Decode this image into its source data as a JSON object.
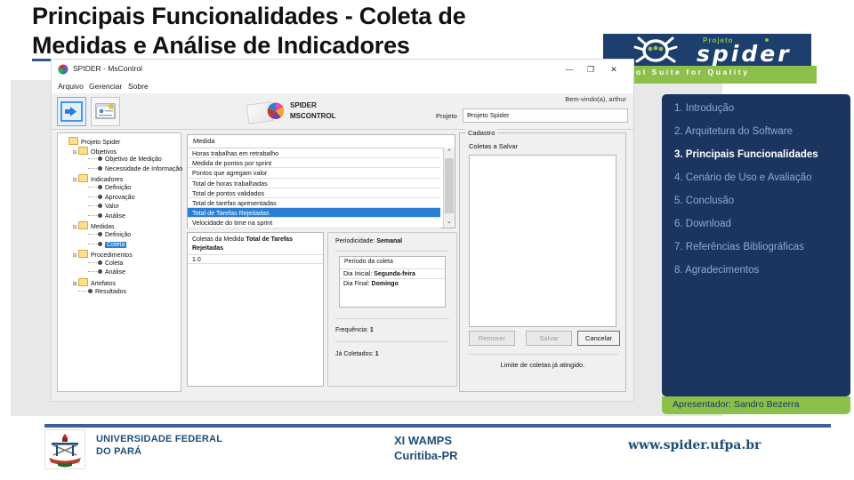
{
  "slide": {
    "title_line1": "Principais Funcionalidades - Coleta de",
    "title_line2": "Medidas e Análise de Indicadores",
    "accent_blue": "#1c3560",
    "accent_green": "#8cc04a",
    "rule_blue": "#3d6096"
  },
  "spider_logo": {
    "projeto": "Projeto",
    "word": "spider",
    "tagline": "Tool Suite for Quality"
  },
  "app": {
    "window_title": "SPIDER - MsControl",
    "controls": {
      "minimize": "—",
      "maximize": "❐",
      "close": "✕"
    },
    "menu": [
      "Arquivo",
      "Gerenciar",
      "Sobre"
    ],
    "logo_line1": "SPIDER",
    "logo_line2": "MSCONTROL",
    "welcome": "Bem-vindo(a), arthur",
    "project_label": "Projeto",
    "project_value": "Projeto Spider",
    "project_chevron": "⌄",
    "tree": [
      {
        "label": "Projeto Spider",
        "depth": 0,
        "kind": "folder",
        "expander": ""
      },
      {
        "label": "Objetivos",
        "depth": 1,
        "kind": "folder",
        "expander": "−"
      },
      {
        "label": "Objetivo de Medição",
        "depth": 2,
        "kind": "leaf",
        "expander": ""
      },
      {
        "label": "Necessidade de Informação",
        "depth": 2,
        "kind": "leaf",
        "expander": ""
      },
      {
        "label": "Indicadores",
        "depth": 1,
        "kind": "folder",
        "expander": "−"
      },
      {
        "label": "Definição",
        "depth": 2,
        "kind": "leaf",
        "expander": ""
      },
      {
        "label": "Aprovação",
        "depth": 2,
        "kind": "leaf",
        "expander": ""
      },
      {
        "label": "Valor",
        "depth": 2,
        "kind": "leaf",
        "expander": ""
      },
      {
        "label": "Análise",
        "depth": 2,
        "kind": "leaf",
        "expander": ""
      },
      {
        "label": "Medidas",
        "depth": 1,
        "kind": "folder",
        "expander": "−"
      },
      {
        "label": "Definição",
        "depth": 2,
        "kind": "leaf",
        "expander": ""
      },
      {
        "label": "Coleta",
        "depth": 2,
        "kind": "leaf",
        "expander": "",
        "selected": true
      },
      {
        "label": "Procedimentos",
        "depth": 1,
        "kind": "folder",
        "expander": "−"
      },
      {
        "label": "Coleta",
        "depth": 2,
        "kind": "leaf",
        "expander": ""
      },
      {
        "label": "Análise",
        "depth": 2,
        "kind": "leaf",
        "expander": ""
      },
      {
        "label": "Artefatos",
        "depth": 1,
        "kind": "folder",
        "expander": "+"
      },
      {
        "label": "Resultados",
        "depth": 1,
        "kind": "leaf",
        "expander": ""
      }
    ],
    "measure_list": {
      "header": "Medida",
      "rows": [
        "Horas trabalhas em retrabalho",
        "Medida de pontos por sprint",
        "Pontos que agregam valor",
        "Total de horas trabalhadas",
        "Total de pontos validados",
        "Total de tarefas apresentadas",
        "Total de Tarefas Rejeitadas",
        "Velocidade do time na sprint"
      ],
      "selected_index": 6,
      "scroll_up": "⌃",
      "scroll_down": "⌄"
    },
    "coletas": {
      "title_prefix": "Coletas da Medida ",
      "title_strong": "Total de Tarefas Rejeitadas",
      "value": "1.0"
    },
    "periodicidade": {
      "label": "Periodicidade: ",
      "value": "Semanal",
      "periodo_header": "Período da coleta",
      "dia_inicial_label": "Dia Inicial: ",
      "dia_inicial_value": "Segunda-feira",
      "dia_final_label": "Dia Final: ",
      "dia_final_value": "Domingo",
      "frequencia_label": "Frequência: ",
      "frequencia_value": "1",
      "coletados_label": "Já Coletados: ",
      "coletados_value": "1"
    },
    "cadastro": {
      "legend": "Cadastro",
      "sub_label": "Coletas a Salvar",
      "btn_remover": "Remover",
      "btn_salvar": "Salvar",
      "btn_cancelar": "Cancelar",
      "note": "Limite de coletas já atingido."
    }
  },
  "nav": {
    "items": [
      {
        "label": "1. Introdução",
        "active": false
      },
      {
        "label": "2. Arquitetura do Software",
        "active": false
      },
      {
        "label": "3. Principais  Funcionalidades",
        "active": true
      },
      {
        "label": "4. Cenário de Uso e Avaliação",
        "active": false
      },
      {
        "label": "5. Conclusão",
        "active": false
      },
      {
        "label": "6. Download",
        "active": false
      },
      {
        "label": "7. Referências Bibliográficas",
        "active": false
      },
      {
        "label": "8. Agradecimentos",
        "active": false
      }
    ],
    "presenter": "Apresentador: Sandro Bezerra"
  },
  "footer": {
    "university_line1": "UNIVERSIDADE FEDERAL",
    "university_line2": "DO PARÁ",
    "event_line1": "XI WAMPS",
    "event_line2": "Curitiba-PR",
    "site": "www.spider.ufpa.br"
  }
}
